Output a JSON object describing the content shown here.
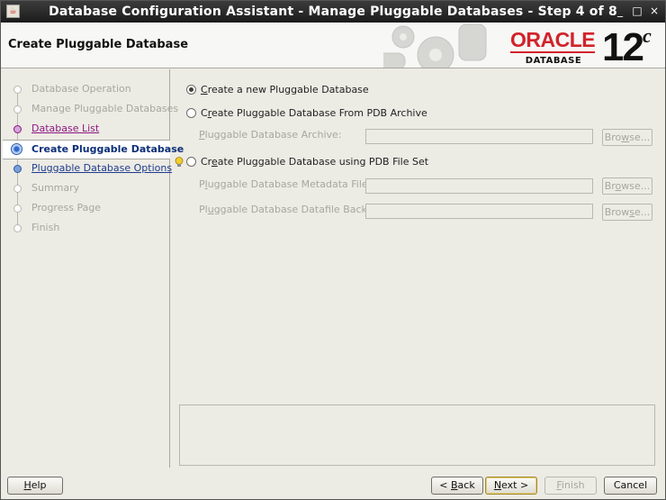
{
  "window": {
    "title": "Database Configuration Assistant - Manage Pluggable Databases - Step 4 of 8",
    "controls": [
      "_",
      "□",
      "×"
    ]
  },
  "header": {
    "title": "Create Pluggable Database",
    "logo_word": "ORACLE",
    "logo_sub": "DATABASE",
    "version": "12",
    "version_sup": "c",
    "brand_color": "#d2232a"
  },
  "nav": {
    "steps": [
      {
        "label": "Database Operation",
        "state": "disabled"
      },
      {
        "label": "Manage Pluggable Databases",
        "state": "disabled"
      },
      {
        "label": "Database List",
        "state": "visited"
      },
      {
        "label": "Create Pluggable Database",
        "state": "current"
      },
      {
        "label": "Pluggable Database Options",
        "state": "link"
      },
      {
        "label": "Summary",
        "state": "disabled"
      },
      {
        "label": "Progress Page",
        "state": "disabled"
      },
      {
        "label": "Finish",
        "state": "disabled"
      }
    ]
  },
  "options": {
    "new_pdb": {
      "prefix": "",
      "mnemonic": "C",
      "rest": "reate a new Pluggable Database",
      "selected": true
    },
    "from_archive": {
      "prefix": "C",
      "mnemonic": "r",
      "rest": "eate Pluggable Database From PDB Archive",
      "selected": false
    },
    "archive_label": {
      "mnemonic": "P",
      "rest": "luggable Database Archive:"
    },
    "from_fileset": {
      "prefix": "Cr",
      "mnemonic": "e",
      "rest": "ate Pluggable Database using PDB File Set",
      "selected": false
    },
    "metadata_label": {
      "prefix": "P",
      "mnemonic": "l",
      "rest": "uggable Database Metadata File:"
    },
    "datafile_label": {
      "prefix": "Pl",
      "mnemonic": "u",
      "rest": "ggable Database Datafile Backup:"
    },
    "browse_labels": [
      {
        "prefix": "Bro",
        "mnemonic": "w",
        "rest": "se..."
      },
      {
        "prefix": "Br",
        "mnemonic": "o",
        "rest": "wse..."
      },
      {
        "prefix": "Brow",
        "mnemonic": "s",
        "rest": "e..."
      }
    ]
  },
  "buttons": {
    "help": {
      "prefix": "",
      "mnemonic": "H",
      "rest": "elp"
    },
    "back": {
      "prefix": "< ",
      "mnemonic": "B",
      "rest": "ack"
    },
    "next": {
      "prefix": "",
      "mnemonic": "N",
      "rest": "ext >"
    },
    "finish": {
      "prefix": "",
      "mnemonic": "F",
      "rest": "inish"
    },
    "cancel": {
      "prefix": "",
      "mnemonic": "",
      "rest": "Cancel"
    }
  }
}
